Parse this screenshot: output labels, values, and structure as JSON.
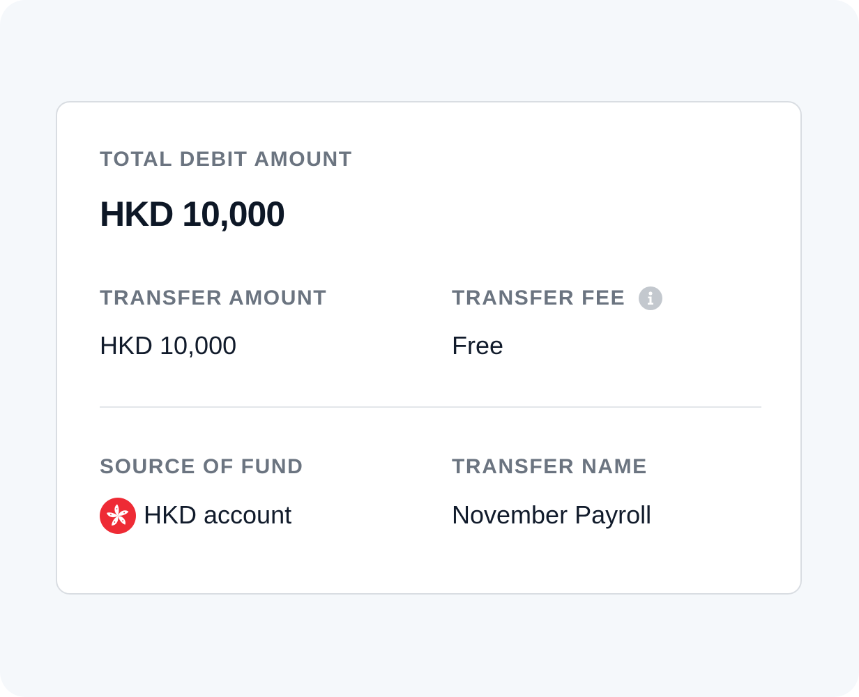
{
  "summary": {
    "total_debit_label": "TOTAL DEBIT AMOUNT",
    "total_debit_value": "HKD 10,000",
    "transfer_amount_label": "TRANSFER AMOUNT",
    "transfer_amount_value": "HKD 10,000",
    "transfer_fee_label": "TRANSFER FEE",
    "transfer_fee_value": "Free",
    "transfer_fee_info_icon": "info-icon",
    "source_of_fund_label": "SOURCE OF FUND",
    "source_of_fund_value": "HKD account",
    "source_of_fund_icon": "hong-kong-flag-icon",
    "transfer_name_label": "TRANSFER NAME",
    "transfer_name_value": "November Payroll"
  },
  "colors": {
    "page_background": "#f5f8fb",
    "card_background": "#ffffff",
    "card_border": "#d9dde2",
    "label_text": "#6b7480",
    "value_text": "#111b2b",
    "info_icon": "#c3c8ce",
    "flag_red": "#ee2b35"
  }
}
